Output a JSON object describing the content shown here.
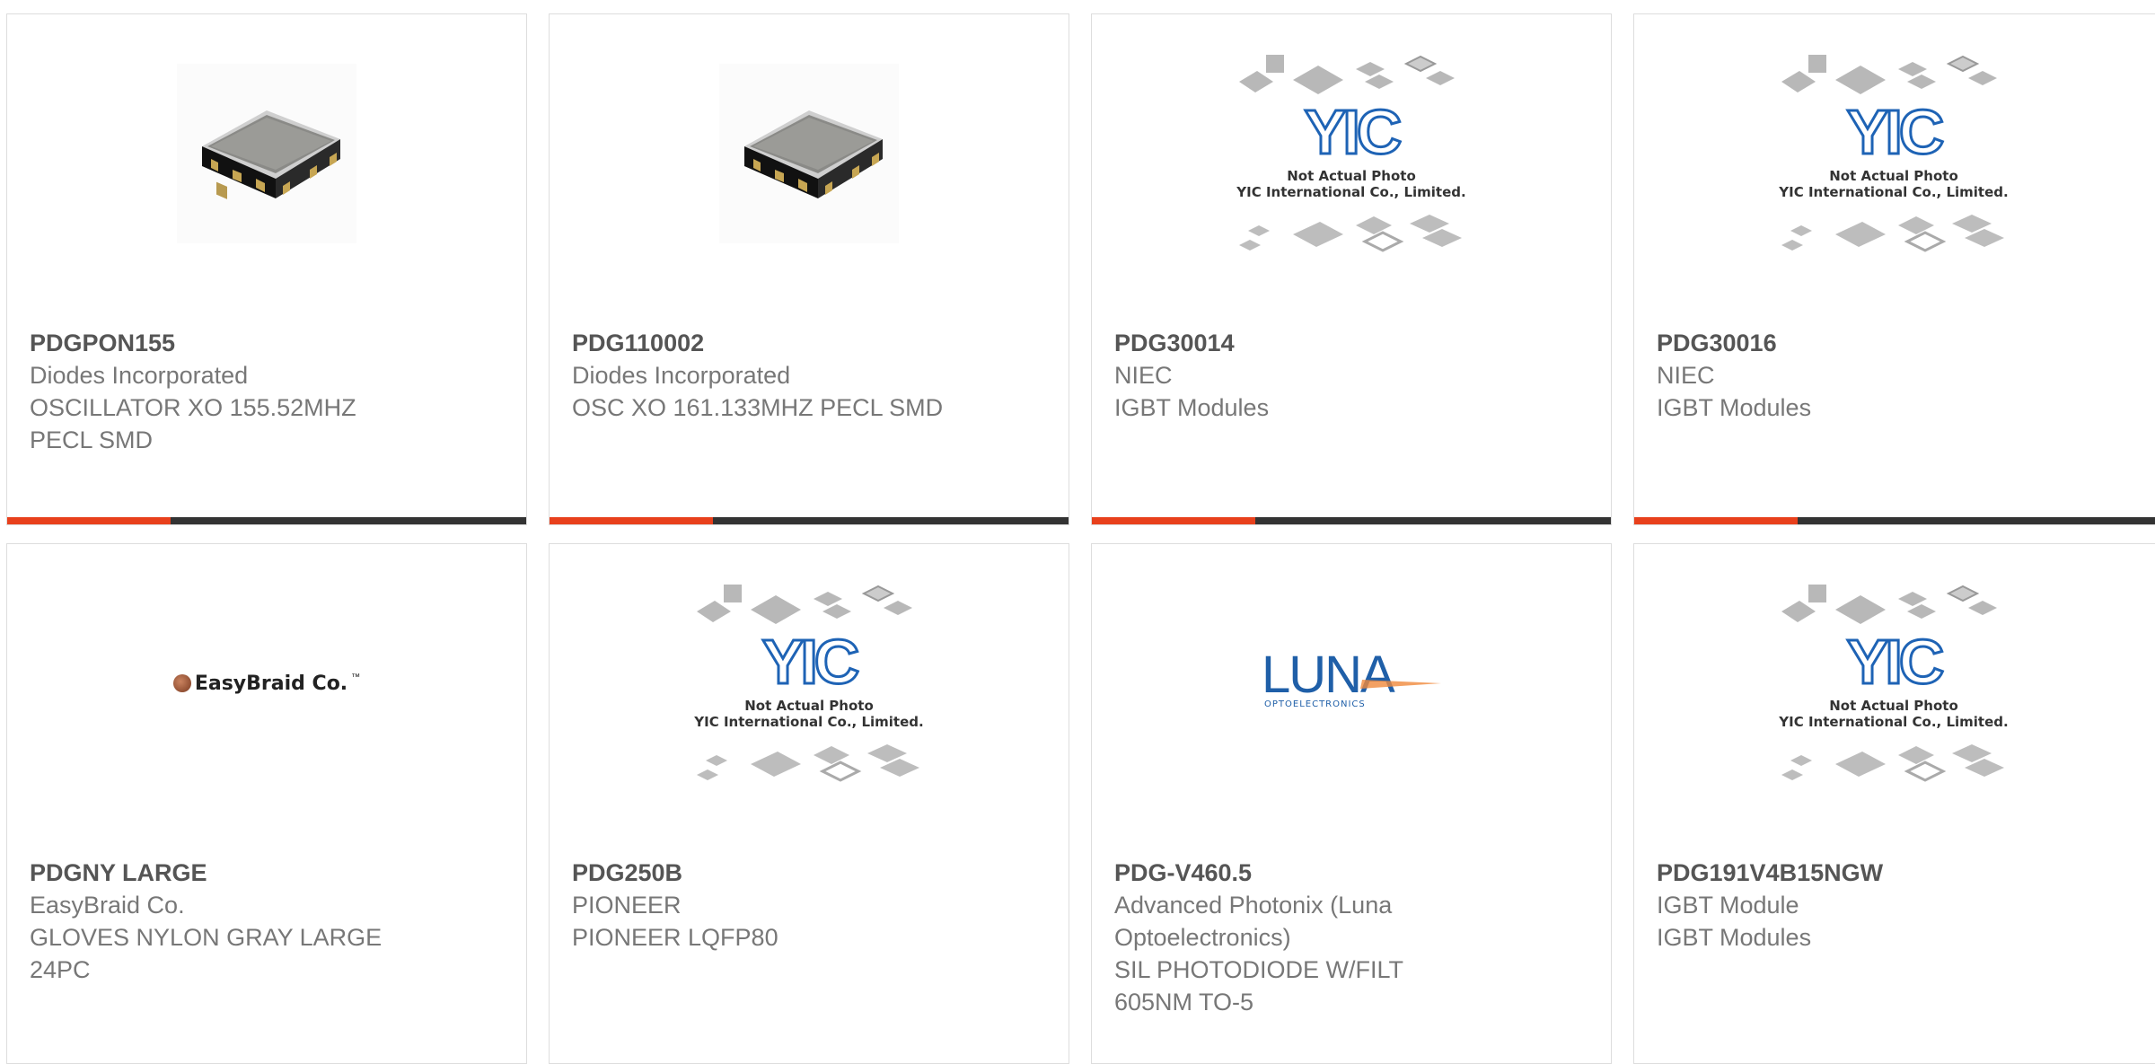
{
  "products": [
    {
      "part_number": "PDGPON155",
      "manufacturer": "Diodes Incorporated",
      "description": "OSCILLATOR XO 155.52MHZ PECL SMD",
      "image": "oscillator-chip-photo"
    },
    {
      "part_number": "PDG110002",
      "manufacturer": "Diodes Incorporated",
      "description": "OSC XO 161.133MHZ PECL SMD",
      "image": "oscillator-chip-photo"
    },
    {
      "part_number": "PDG30014",
      "manufacturer": "NIEC",
      "description": "IGBT Modules",
      "image": "yic-placeholder"
    },
    {
      "part_number": "PDG30016",
      "manufacturer": "NIEC",
      "description": "IGBT Modules",
      "image": "yic-placeholder"
    },
    {
      "part_number": "PDGNY LARGE",
      "manufacturer": "EasyBraid Co.",
      "description": "GLOVES NYLON GRAY LARGE 24PC",
      "image": "easybraid-logo"
    },
    {
      "part_number": "PDG250B",
      "manufacturer": "PIONEER",
      "description": "PIONEER LQFP80",
      "image": "yic-placeholder"
    },
    {
      "part_number": "PDG-V460.5",
      "manufacturer": "Advanced Photonix (Luna Optoelectronics)",
      "description": "SIL PHOTODIODE W/FILT 605NM TO-5",
      "image": "luna-logo"
    },
    {
      "part_number": "PDG191V4B15NGW",
      "manufacturer": "IGBT Module",
      "description": "IGBT Modules",
      "image": "yic-placeholder"
    }
  ],
  "placeholder": {
    "brand": "YIC",
    "line1": "Not Actual Photo",
    "line2": "YIC International Co., Limited."
  },
  "logos": {
    "easybraid": "EasyBraid Co.",
    "easybraid_tm": "™",
    "luna_main": "LUNA",
    "luna_sub": "OPTOELECTRONICS"
  },
  "colors": {
    "accent": "#e8401c",
    "bar": "#333333",
    "text": "#777777",
    "pn": "#555555"
  }
}
